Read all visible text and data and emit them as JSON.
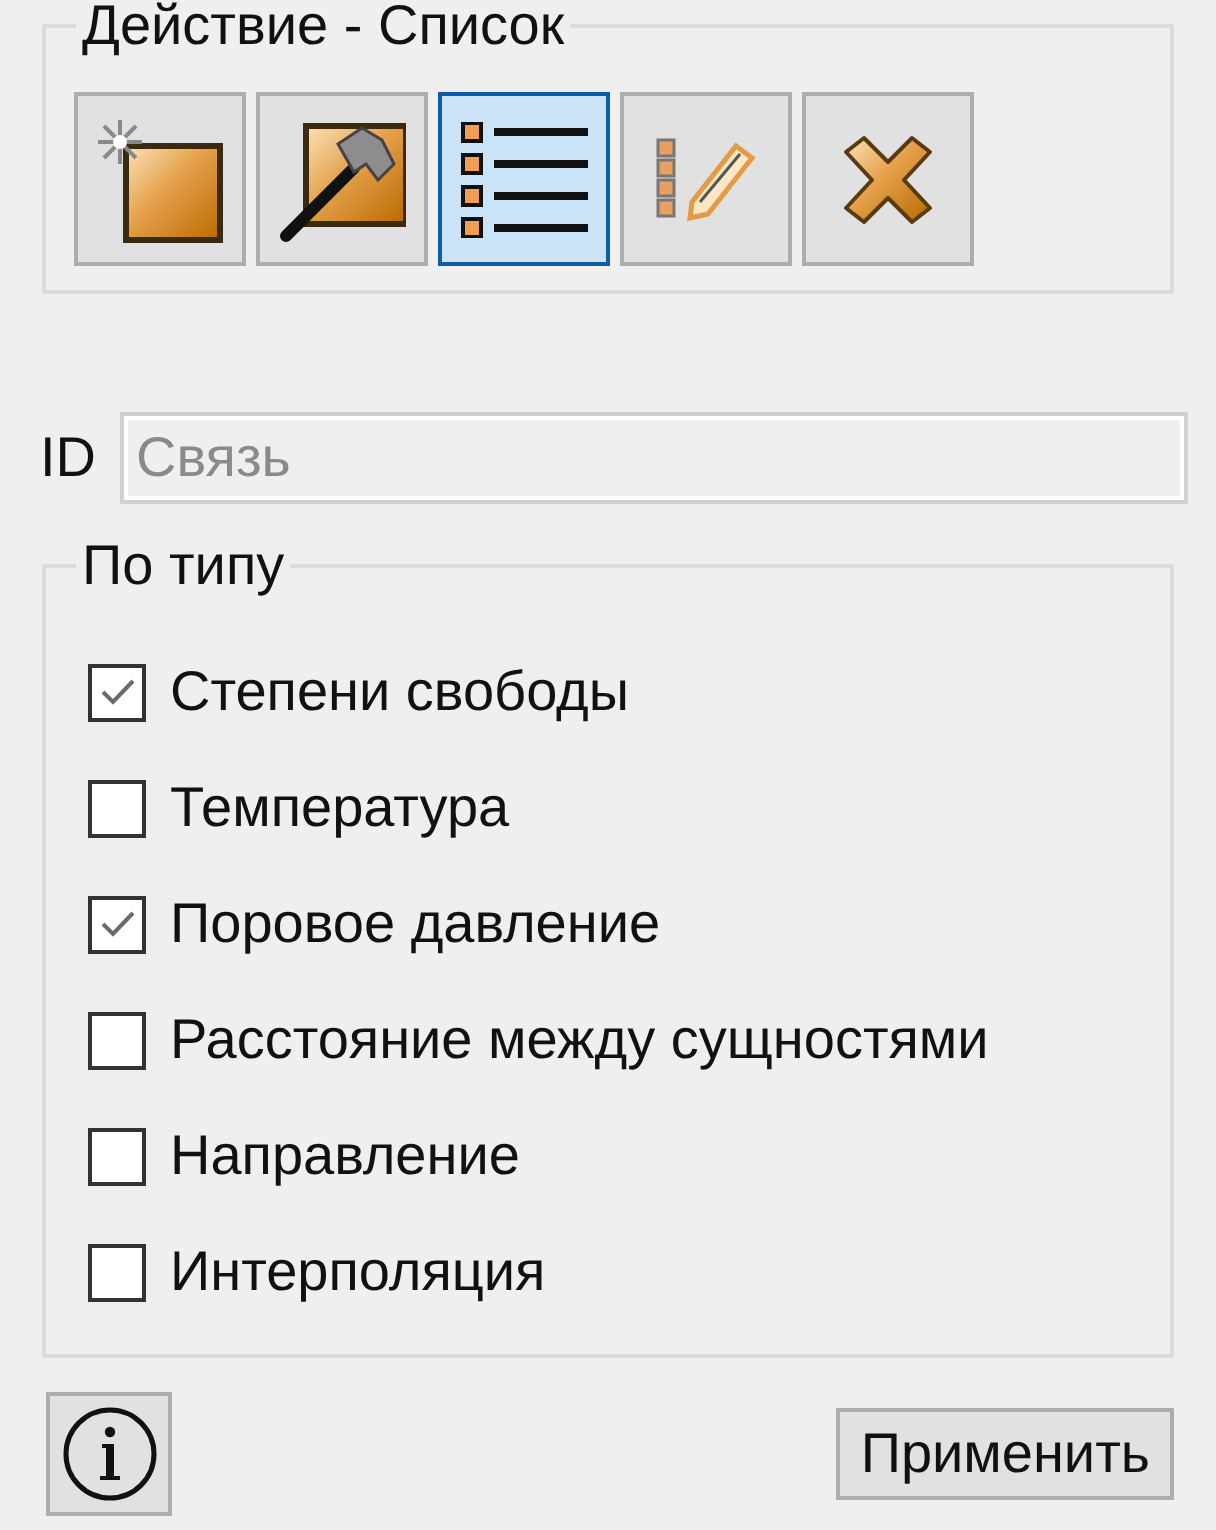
{
  "action_group": {
    "title": "Действие - Список",
    "tools": [
      {
        "kind": "new",
        "selected": false
      },
      {
        "kind": "edit",
        "selected": false
      },
      {
        "kind": "list",
        "selected": true
      },
      {
        "kind": "checklist",
        "selected": false
      },
      {
        "kind": "delete",
        "selected": false
      }
    ]
  },
  "id_field": {
    "label": "ID",
    "placeholder": "Связь"
  },
  "type_filter": {
    "title": "По типу",
    "options": [
      {
        "label": "Степени свободы",
        "checked": true
      },
      {
        "label": "Температура",
        "checked": false
      },
      {
        "label": "Поровое давление",
        "checked": true
      },
      {
        "label": "Расстояние между сущностями",
        "checked": false
      },
      {
        "label": "Направление",
        "checked": false
      },
      {
        "label": "Интерполяция",
        "checked": false
      }
    ]
  },
  "footer": {
    "apply_button": "Применить"
  }
}
